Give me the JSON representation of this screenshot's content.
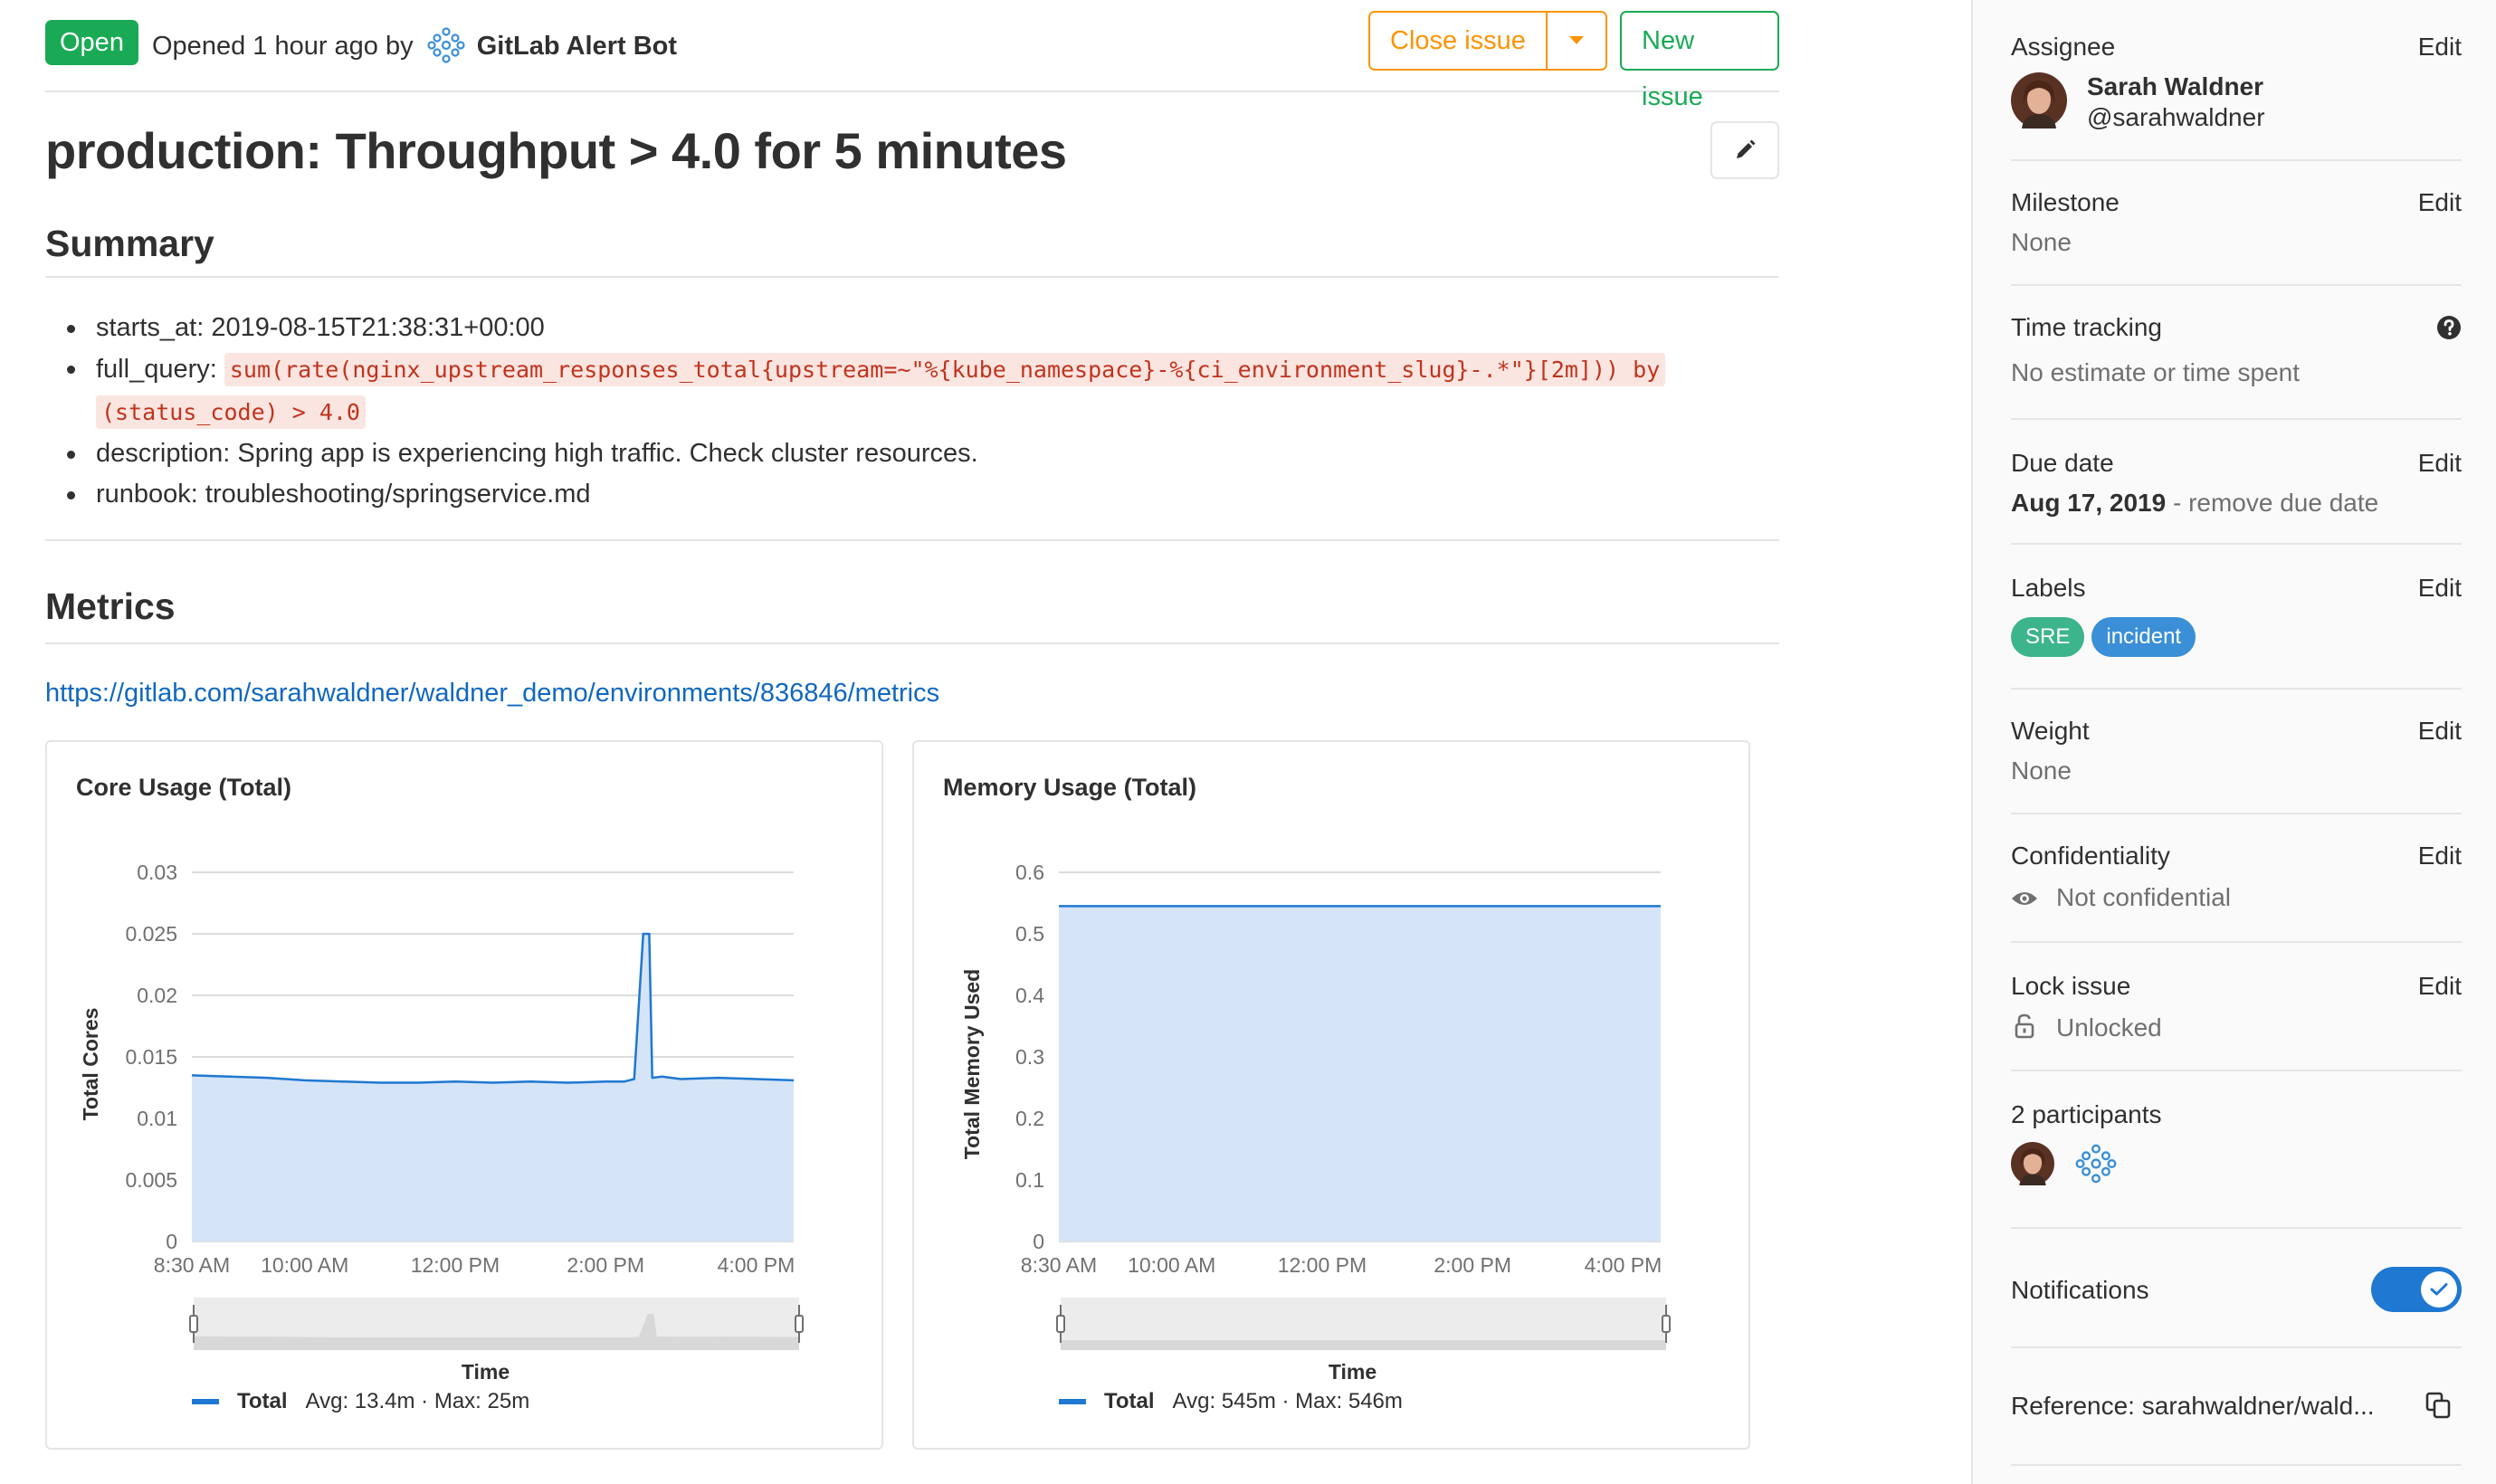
{
  "header": {
    "status": "Open",
    "opened_text": "Opened 1 hour ago by",
    "author": "GitLab Alert Bot",
    "close_label": "Close issue",
    "new_label": "New issue"
  },
  "issue": {
    "title": "production: Throughput > 4.0 for 5 minutes"
  },
  "summary": {
    "heading": "Summary",
    "items": [
      {
        "key": "starts_at:",
        "value": "2019-08-15T21:38:31+00:00"
      },
      {
        "key": "full_query:",
        "query_line1": "sum(rate(nginx_upstream_responses_total{upstream=~\"%{kube_namespace}-%{ci_environment_slug}-.*\"}[2m])) by",
        "query_line2": "(status_code) > 4.0"
      },
      {
        "key": "description:",
        "value": "Spring app is experiencing high traffic. Check cluster resources."
      },
      {
        "key": "runbook:",
        "value": "troubleshooting/springservice.md"
      }
    ]
  },
  "metrics": {
    "heading": "Metrics",
    "link": "https://gitlab.com/sarahwaldner/waldner_demo/environments/836846/metrics"
  },
  "chart_data": [
    {
      "type": "area",
      "title": "Core Usage (Total)",
      "xlabel": "Time",
      "ylabel": "Total Cores",
      "x_ticks": [
        "8:30 AM",
        "10:00 AM",
        "12:00 PM",
        "2:00 PM",
        "4:00 PM"
      ],
      "y_ticks": [
        "0",
        "0.005",
        "0.01",
        "0.015",
        "0.02",
        "0.025",
        "0.03"
      ],
      "ylim": [
        0,
        0.03
      ],
      "x_hours": [
        8.5,
        16.5
      ],
      "series": [
        {
          "name": "Total",
          "x": [
            8.5,
            9.0,
            9.5,
            10.0,
            10.5,
            11.0,
            11.5,
            12.0,
            12.5,
            13.0,
            13.5,
            14.0,
            14.25,
            14.38,
            14.5,
            14.58,
            14.62,
            14.75,
            15.0,
            15.5,
            16.0,
            16.5
          ],
          "values": [
            0.0135,
            0.0134,
            0.0133,
            0.0131,
            0.013,
            0.0129,
            0.0129,
            0.013,
            0.0129,
            0.013,
            0.0129,
            0.013,
            0.013,
            0.0132,
            0.025,
            0.025,
            0.0133,
            0.0134,
            0.0132,
            0.0133,
            0.0132,
            0.0131
          ]
        }
      ],
      "legend": {
        "name": "Total",
        "stats": "Avg: 13.4m · Max: 25m"
      }
    },
    {
      "type": "area",
      "title": "Memory Usage (Total)",
      "xlabel": "Time",
      "ylabel": "Total Memory Used",
      "x_ticks": [
        "8:30 AM",
        "10:00 AM",
        "12:00 PM",
        "2:00 PM",
        "4:00 PM"
      ],
      "y_ticks": [
        "0",
        "0.1",
        "0.2",
        "0.3",
        "0.4",
        "0.5",
        "0.6"
      ],
      "ylim": [
        0,
        0.6
      ],
      "x_hours": [
        8.5,
        16.5
      ],
      "series": [
        {
          "name": "Total",
          "x": [
            8.5,
            10.0,
            12.0,
            14.0,
            16.0,
            16.5
          ],
          "values": [
            0.545,
            0.545,
            0.545,
            0.545,
            0.545,
            0.545
          ]
        }
      ],
      "legend": {
        "name": "Total",
        "stats": "Avg: 545m · Max: 546m"
      }
    }
  ],
  "sidebar": {
    "assignee": {
      "label": "Assignee",
      "edit": "Edit",
      "name": "Sarah Waldner",
      "username": "@sarahwaldner"
    },
    "milestone": {
      "label": "Milestone",
      "edit": "Edit",
      "value": "None"
    },
    "time_tracking": {
      "label": "Time tracking",
      "value": "No estimate or time spent"
    },
    "due_date": {
      "label": "Due date",
      "edit": "Edit",
      "value": "Aug 17, 2019",
      "remove": " - remove due date"
    },
    "labels": {
      "label": "Labels",
      "edit": "Edit",
      "items": [
        {
          "name": "SRE",
          "color": "#3cb48c"
        },
        {
          "name": "incident",
          "color": "#3a8fd6"
        }
      ]
    },
    "weight": {
      "label": "Weight",
      "edit": "Edit",
      "value": "None"
    },
    "confidentiality": {
      "label": "Confidentiality",
      "edit": "Edit",
      "value": "Not confidential"
    },
    "lock": {
      "label": "Lock issue",
      "edit": "Edit",
      "value": "Unlocked"
    },
    "participants": {
      "label": "2 participants"
    },
    "notifications": {
      "label": "Notifications",
      "enabled": true
    },
    "reference": {
      "label": "Reference: sarahwaldner/wald..."
    }
  },
  "colors": {
    "open": "#1aaa55",
    "warning": "#fc9403",
    "link": "#1068bf",
    "series": "#1f78d1",
    "area": "#d6e4f7"
  }
}
